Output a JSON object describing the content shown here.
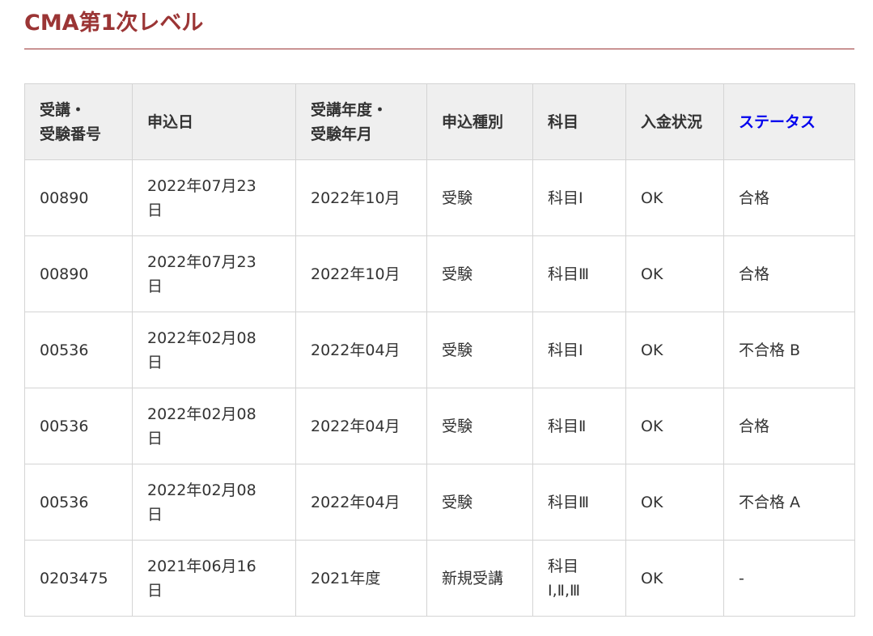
{
  "page": {
    "title": "CMA第1次レベル",
    "accent_color": "#9b3535",
    "link_color": "#0000ee"
  },
  "table": {
    "headers": {
      "number": [
        "受講・",
        "受験番号"
      ],
      "application_date": "申込日",
      "year_month": [
        "受講年度・",
        "受験年月"
      ],
      "application_type": "申込種別",
      "subject": "科目",
      "payment_status": "入金状況",
      "status": "ステータス"
    },
    "rows": [
      {
        "number": "00890",
        "application_date": [
          "2022年07月23",
          "日"
        ],
        "year_month": "2022年10月",
        "application_type": "受験",
        "subject": [
          "科目Ⅰ"
        ],
        "payment_status": "OK",
        "status": "合格"
      },
      {
        "number": "00890",
        "application_date": [
          "2022年07月23",
          "日"
        ],
        "year_month": "2022年10月",
        "application_type": "受験",
        "subject": [
          "科目Ⅲ"
        ],
        "payment_status": "OK",
        "status": "合格"
      },
      {
        "number": "00536",
        "application_date": [
          "2022年02月08",
          "日"
        ],
        "year_month": "2022年04月",
        "application_type": "受験",
        "subject": [
          "科目Ⅰ"
        ],
        "payment_status": "OK",
        "status": "不合格 B"
      },
      {
        "number": "00536",
        "application_date": [
          "2022年02月08",
          "日"
        ],
        "year_month": "2022年04月",
        "application_type": "受験",
        "subject": [
          "科目Ⅱ"
        ],
        "payment_status": "OK",
        "status": "合格"
      },
      {
        "number": "00536",
        "application_date": [
          "2022年02月08",
          "日"
        ],
        "year_month": "2022年04月",
        "application_type": "受験",
        "subject": [
          "科目Ⅲ"
        ],
        "payment_status": "OK",
        "status": "不合格 A"
      },
      {
        "number": "0203475",
        "application_date": [
          "2021年06月16",
          "日"
        ],
        "year_month": "2021年度",
        "application_type": "新規受講",
        "subject": [
          "科目",
          "Ⅰ,Ⅱ,Ⅲ"
        ],
        "payment_status": "OK",
        "status": "-"
      }
    ]
  }
}
